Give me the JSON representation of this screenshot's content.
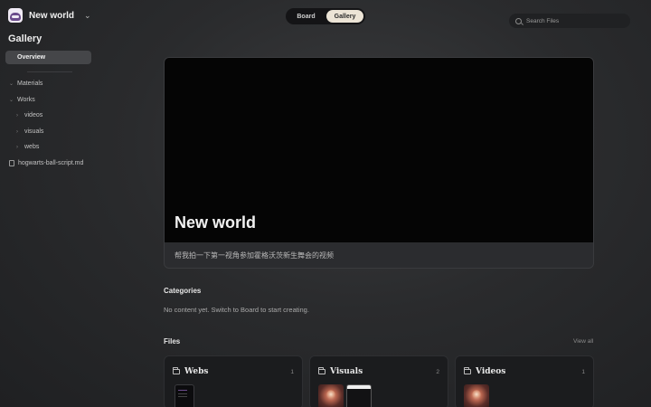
{
  "app": {
    "workspace_name": "New world"
  },
  "sidebar": {
    "title": "Gallery",
    "overview_label": "Overview",
    "items": [
      {
        "label": "Materials"
      },
      {
        "label": "Works"
      },
      {
        "label": "videos"
      },
      {
        "label": "visuals"
      },
      {
        "label": "webs"
      },
      {
        "label": "hogwarts-ball-script.md"
      }
    ]
  },
  "tabs": [
    {
      "label": "Board",
      "active": false
    },
    {
      "label": "Gallery",
      "active": true
    }
  ],
  "search": {
    "placeholder": "Search Files"
  },
  "hero": {
    "title": "New world",
    "description": "帮我拍一下第一视角参加霍格沃茨新生舞会的视频"
  },
  "categories": {
    "title": "Categories",
    "empty_text": "No content yet. Switch to Board to start creating."
  },
  "files": {
    "title": "Files",
    "view_all": "View all",
    "cards": [
      {
        "name": "Webs",
        "count": "1"
      },
      {
        "name": "Visuals",
        "count": "2"
      },
      {
        "name": "Videos",
        "count": "1"
      }
    ]
  },
  "colors": {
    "accent_tab": "#ece4d6",
    "sidebar_selected": "#454649",
    "hero_media": "#050505"
  }
}
